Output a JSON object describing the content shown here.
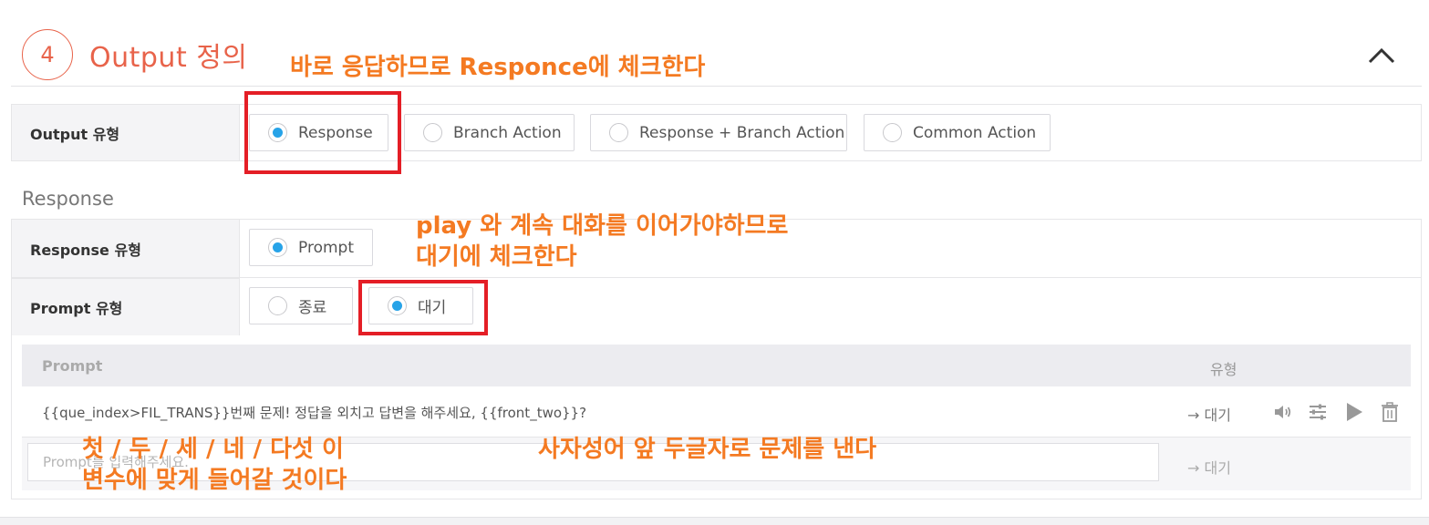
{
  "section": {
    "number": "4",
    "title": "Output 정의"
  },
  "output_type": {
    "label": "Output 유형",
    "options": [
      {
        "label": "Response",
        "selected": true
      },
      {
        "label": "Branch Action",
        "selected": false
      },
      {
        "label": "Response + Branch Action",
        "selected": false
      },
      {
        "label": "Common Action",
        "selected": false
      }
    ]
  },
  "response": {
    "title": "Response",
    "response_type": {
      "label": "Response 유형",
      "options": [
        {
          "label": "Prompt",
          "selected": true
        }
      ]
    },
    "prompt_type": {
      "label": "Prompt 유형",
      "options": [
        {
          "label": "종료",
          "selected": false
        },
        {
          "label": "대기",
          "selected": true
        }
      ]
    }
  },
  "prompt_table": {
    "headers": {
      "prompt": "Prompt",
      "type": "유형"
    },
    "rows": [
      {
        "text": "{{que_index>FIL_TRANS}}번째 문제! 정답을 외치고 답변을 해주세요,  {{front_two}}?",
        "type": "→ 대기"
      }
    ],
    "new_row": {
      "placeholder": "Prompt를 입력해주세요.",
      "type": "→ 대기"
    }
  },
  "annotations": {
    "a1": "바로 응답하므로 Responce에 체크한다",
    "a2_line1": "play 와 계속 대화를 이어가야하므로",
    "a2_line2": "대기에 체크한다",
    "a3_line1": "첫 / 두 / 세 / 네 / 다섯  이",
    "a3_line2": "변수에 맞게 들어갈 것이다",
    "a4": "사자성어 앞 두글자로 문제를 낸다"
  },
  "colors": {
    "accent": "#e8634a",
    "radio_on": "#27a3e8",
    "highlight": "#e41e26",
    "annotation": "#f47a22"
  },
  "icons": [
    "chevron-up-icon",
    "speaker-icon",
    "sliders-icon",
    "play-icon",
    "trash-icon"
  ]
}
